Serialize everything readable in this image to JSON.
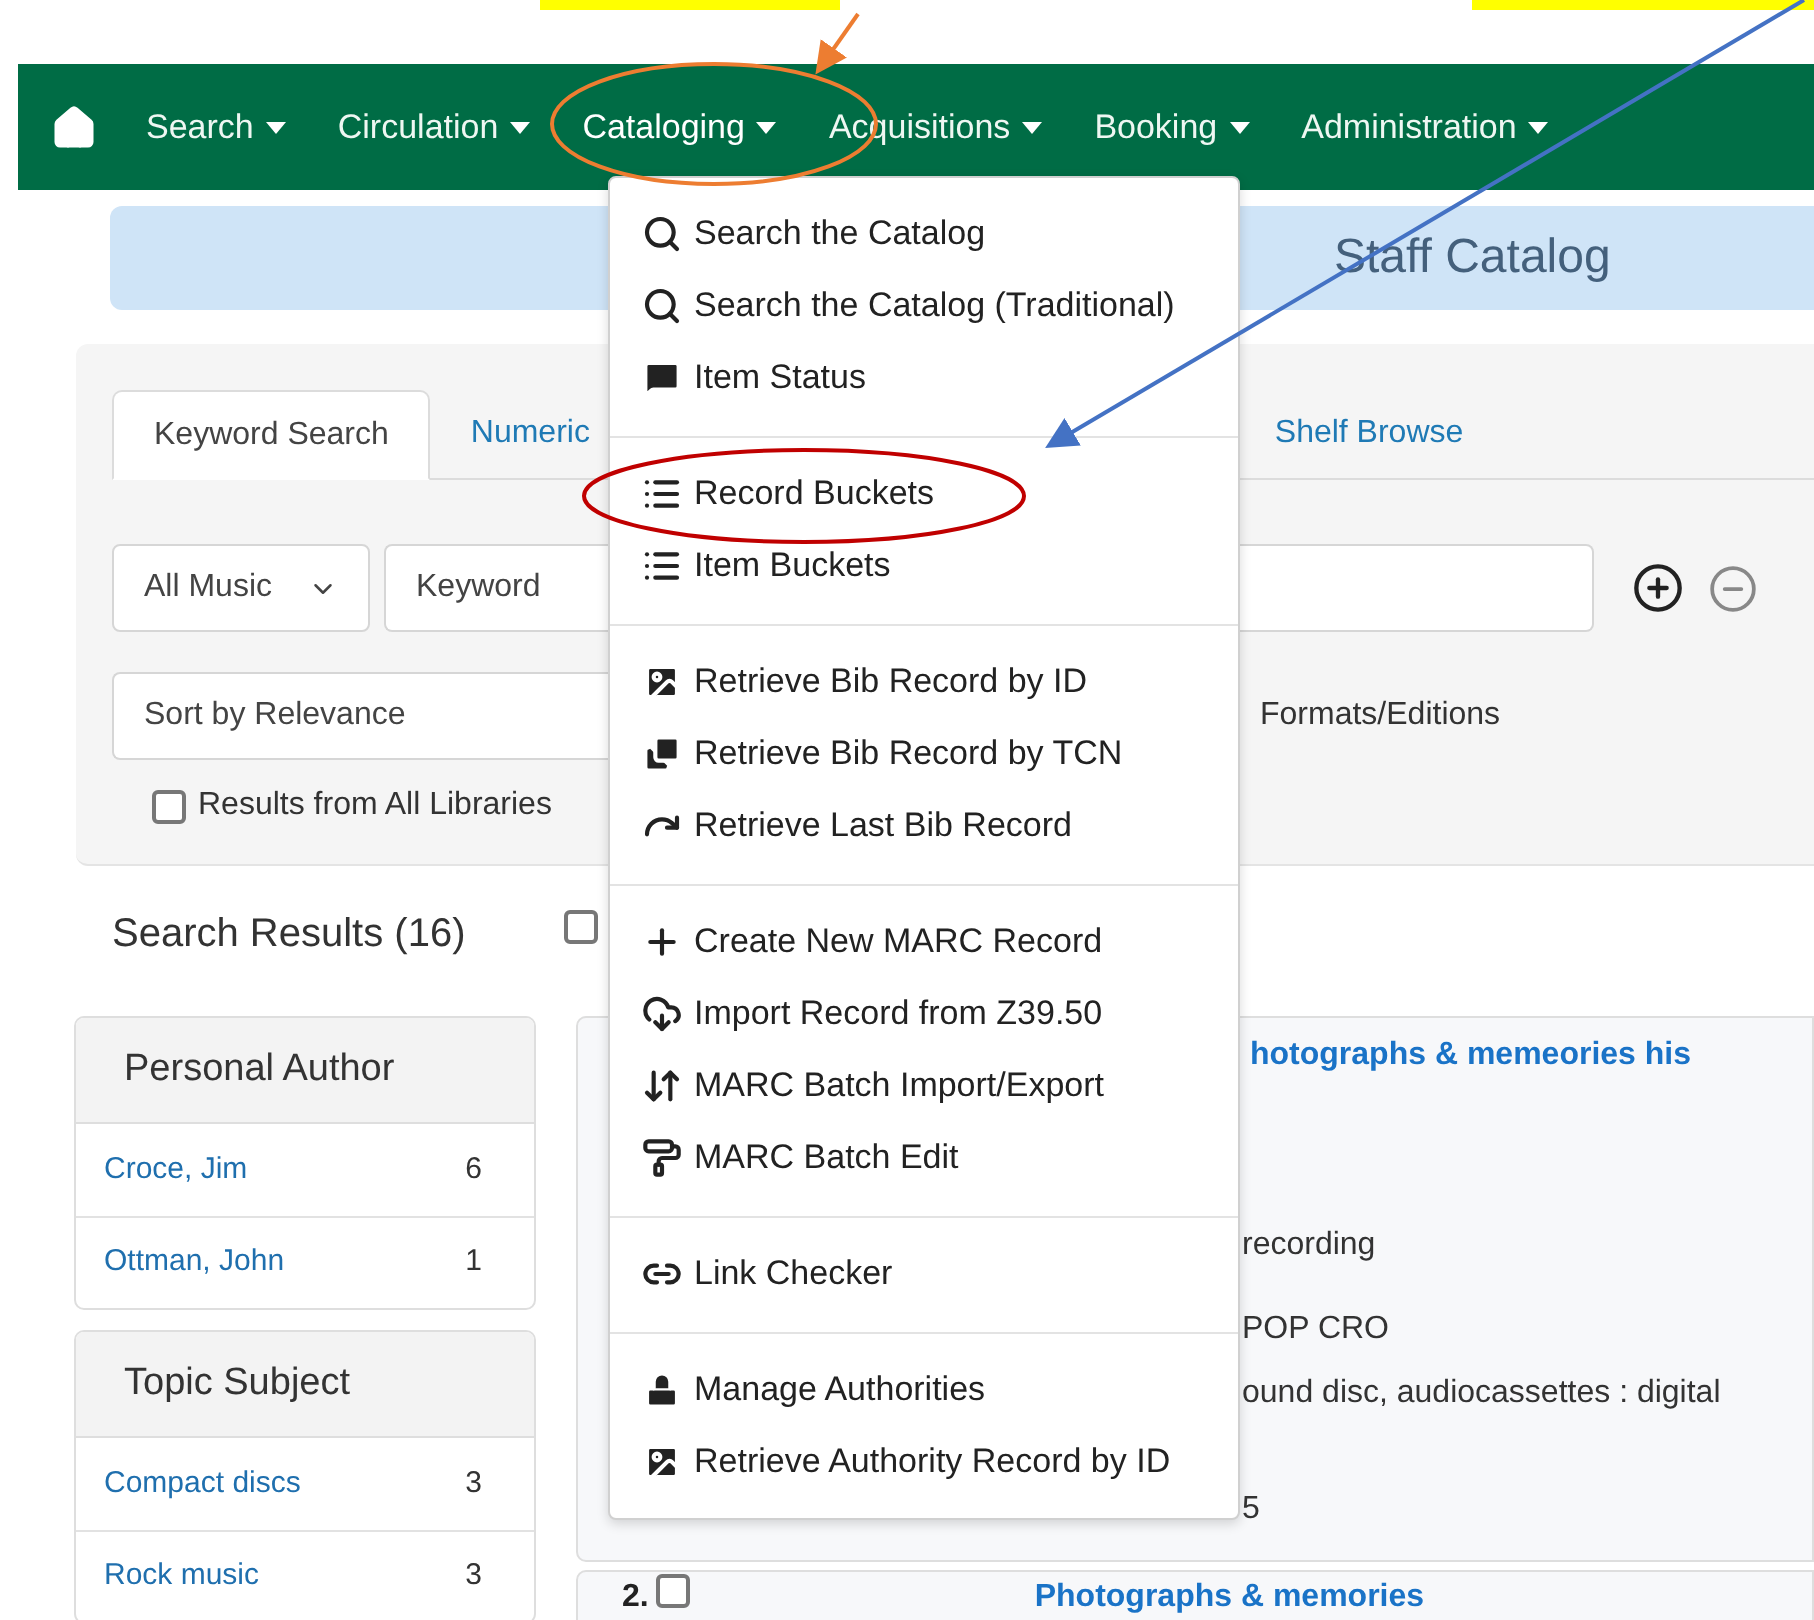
{
  "nav": {
    "items": [
      {
        "label": "Search",
        "expanded": false
      },
      {
        "label": "Circulation",
        "expanded": false
      },
      {
        "label": "Cataloging",
        "expanded": true
      },
      {
        "label": "Acquisitions",
        "expanded": false
      },
      {
        "label": "Booking",
        "expanded": false
      },
      {
        "label": "Administration",
        "expanded": false
      }
    ]
  },
  "menu": {
    "groups": [
      {
        "items": [
          "Search the Catalog",
          "Search the Catalog (Traditional)",
          "Item Status"
        ]
      },
      {
        "items": [
          "Record Buckets",
          "Item Buckets"
        ]
      },
      {
        "items": [
          "Retrieve Bib Record by ID",
          "Retrieve Bib Record by TCN",
          "Retrieve Last Bib Record"
        ]
      },
      {
        "items": [
          "Create New MARC Record",
          "Import Record from Z39.50",
          "MARC Batch Import/Export",
          "MARC Batch Edit"
        ]
      },
      {
        "items": [
          "Link Checker"
        ]
      },
      {
        "items": [
          "Manage Authorities",
          "Retrieve Authority Record by ID"
        ]
      }
    ]
  },
  "banner": {
    "title": "Staff Catalog"
  },
  "search_form": {
    "tabs": [
      {
        "label": "Keyword Search",
        "selected": true
      },
      {
        "label": "Numeric",
        "selected": false
      },
      {
        "label": "Shelf Browse",
        "selected": false
      }
    ],
    "format_select": "All Music",
    "field_select": "Keyword",
    "sort_select": "Sort by Relevance",
    "group_option": "Formats/Editions",
    "all_libraries": {
      "label": "Results from All Libraries",
      "checked": false
    }
  },
  "results": {
    "title": "Search Results (16)",
    "select_all_checked": false,
    "facets": [
      {
        "title": "Personal Author",
        "entries": [
          {
            "label": "Croce, Jim",
            "count": "6"
          },
          {
            "label": "Ottman, John",
            "count": "1"
          }
        ]
      },
      {
        "title": "Topic Subject",
        "entries": [
          {
            "label": "Compact discs",
            "count": "3"
          },
          {
            "label": "Rock music",
            "count": "3"
          }
        ]
      }
    ],
    "records": [
      {
        "title": "hotographs & memeories his",
        "lines": [
          "recording",
          "POP CRO",
          "ound disc, audiocassettes : digital",
          "5"
        ]
      },
      {
        "number": "2.",
        "checked": false,
        "title": "Photographs & memories"
      }
    ]
  }
}
